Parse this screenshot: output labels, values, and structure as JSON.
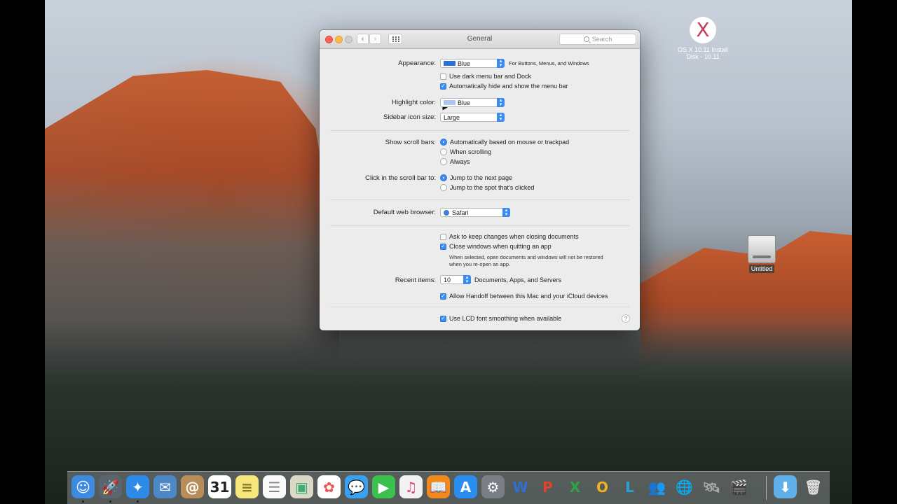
{
  "desktop": {
    "icons": [
      {
        "label_line1": "OS X 10.11 Install",
        "label_line2": "Disk - 10.11",
        "glyph": "X"
      },
      {
        "label": "Untitled"
      }
    ]
  },
  "window": {
    "title": "General",
    "search_placeholder": "Search",
    "appearance": {
      "label": "Appearance:",
      "value": "Blue",
      "hint": "For Buttons, Menus, and Windows",
      "swatch": "#2d6fd6"
    },
    "dark_menu": {
      "label": "Use dark menu bar and Dock",
      "checked": false
    },
    "auto_hide": {
      "label": "Automatically hide and show the menu bar",
      "checked": true
    },
    "highlight": {
      "label": "Highlight color:",
      "value": "Blue",
      "swatch": "#a9c8f5"
    },
    "sidebar_size": {
      "label": "Sidebar icon size:",
      "value": "Large"
    },
    "scroll_bars": {
      "label": "Show scroll bars:",
      "options": [
        "Automatically based on mouse or trackpad",
        "When scrolling",
        "Always"
      ],
      "selected": 0
    },
    "click_scroll": {
      "label": "Click in the scroll bar to:",
      "options": [
        "Jump to the next page",
        "Jump to the spot that’s clicked"
      ],
      "selected": 0
    },
    "browser": {
      "label": "Default web browser:",
      "value": "Safari"
    },
    "ask_keep": {
      "label": "Ask to keep changes when closing documents",
      "checked": false
    },
    "close_windows": {
      "label": "Close windows when quitting an app",
      "checked": true
    },
    "close_note_1": "When selected, open documents and windows will not be restored",
    "close_note_2": "when you re-open an app.",
    "recent": {
      "label": "Recent items:",
      "value": "10",
      "suffix": "Documents, Apps, and Servers"
    },
    "handoff": {
      "label": "Allow Handoff between this Mac and your iCloud devices",
      "checked": true
    },
    "lcd": {
      "label": "Use LCD font smoothing when available",
      "checked": true
    },
    "help_glyph": "?"
  },
  "dock": {
    "apps": [
      {
        "name": "finder",
        "glyph": "☺",
        "color": "#3d8be0"
      },
      {
        "name": "launchpad",
        "glyph": "🚀",
        "color": "#5a6570"
      },
      {
        "name": "safari",
        "glyph": "✦",
        "color": "#2d8ae8"
      },
      {
        "name": "mail",
        "glyph": "✉",
        "color": "#4c87c6"
      },
      {
        "name": "contacts",
        "glyph": "@",
        "color": "#b78d58"
      },
      {
        "name": "calendar",
        "glyph": "31",
        "color": "#ffffff",
        "fg": "#222"
      },
      {
        "name": "notes",
        "glyph": "≡",
        "color": "#f7e77a",
        "fg": "#8a7a2a"
      },
      {
        "name": "reminders",
        "glyph": "☰",
        "color": "#fafafa",
        "fg": "#888"
      },
      {
        "name": "preview",
        "glyph": "▣",
        "color": "#d9d9c6",
        "fg": "#4a7"
      },
      {
        "name": "photos",
        "glyph": "✿",
        "color": "#ffffff",
        "fg": "#e55"
      },
      {
        "name": "messages",
        "glyph": "💬",
        "color": "#3aa0f2"
      },
      {
        "name": "facetime",
        "glyph": "▶",
        "color": "#3cc04e"
      },
      {
        "name": "itunes",
        "glyph": "♫",
        "color": "#f2f2f2",
        "fg": "#e0467f"
      },
      {
        "name": "ibooks",
        "glyph": "📖",
        "color": "#f08a1c"
      },
      {
        "name": "app-store",
        "glyph": "A",
        "color": "#2a8ef0"
      },
      {
        "name": "system-preferences",
        "glyph": "⚙",
        "color": "#7a7f85"
      },
      {
        "name": "word",
        "glyph": "W",
        "color": "transparent",
        "fg": "#2f6fd0"
      },
      {
        "name": "powerpoint",
        "glyph": "P",
        "color": "transparent",
        "fg": "#e0452c"
      },
      {
        "name": "excel",
        "glyph": "X",
        "color": "transparent",
        "fg": "#2fa24a"
      },
      {
        "name": "outlook",
        "glyph": "O",
        "color": "transparent",
        "fg": "#f0b21e"
      },
      {
        "name": "lync",
        "glyph": "L",
        "color": "transparent",
        "fg": "#27a3d8"
      },
      {
        "name": "messenger",
        "glyph": "👥",
        "color": "transparent",
        "fg": "#3a9c3a"
      },
      {
        "name": "network-utility",
        "glyph": "🌐",
        "color": "transparent",
        "fg": "#3a8"
      },
      {
        "name": "remote-desktop",
        "glyph": "🛰",
        "color": "transparent",
        "fg": "#aaa"
      },
      {
        "name": "imovie",
        "glyph": "🎬",
        "color": "transparent",
        "fg": "#ddd"
      }
    ],
    "downloads": {
      "glyph": "⬇",
      "color": "#5fb0e8"
    },
    "trash": {
      "glyph": "🗑",
      "color": "transparent"
    }
  }
}
